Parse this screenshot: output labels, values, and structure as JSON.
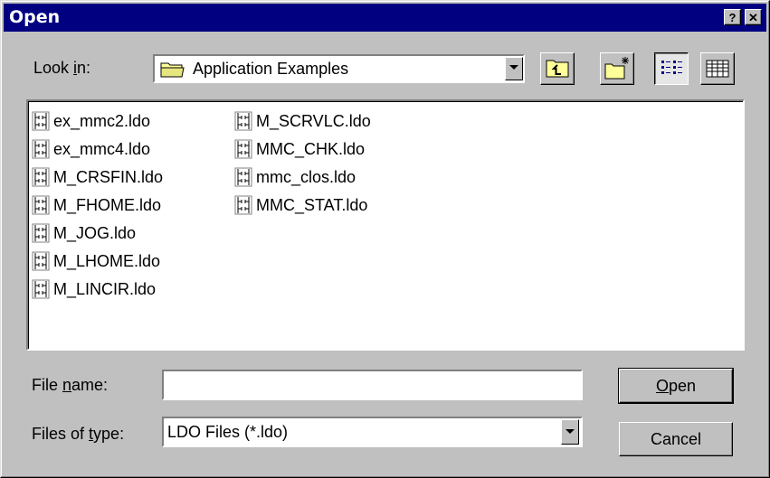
{
  "window": {
    "title": "Open",
    "help_glyph": "?",
    "close_glyph": "✕"
  },
  "lookin": {
    "label_pre": "Look ",
    "label_key": "i",
    "label_post": "n:",
    "value": "Application Examples",
    "icon": "folder-icon"
  },
  "toolbar": {
    "buttons": [
      {
        "name": "up-one-level",
        "icon": "folder-up-icon"
      },
      {
        "name": "create-new-folder",
        "icon": "new-folder-icon"
      },
      {
        "name": "list-view",
        "icon": "list-view-icon",
        "pressed": true
      },
      {
        "name": "details-view",
        "icon": "details-view-icon",
        "pressed": false
      }
    ]
  },
  "files": {
    "col1": [
      "ex_mmc2.ldo",
      "ex_mmc4.ldo",
      "M_CRSFIN.ldo",
      "M_FHOME.ldo",
      "M_JOG.ldo",
      "M_LHOME.ldo",
      "M_LINCIR.ldo"
    ],
    "col2": [
      "M_SCRVLC.ldo",
      "MMC_CHK.ldo",
      "mmc_clos.ldo",
      "MMC_STAT.ldo"
    ],
    "icon": "ldo-file-icon"
  },
  "filename": {
    "label_pre": "File ",
    "label_key": "n",
    "label_post": "ame:",
    "value": ""
  },
  "filetype": {
    "label_pre": "Files of ",
    "label_key": "t",
    "label_post": "ype:",
    "value": "LDO Files (*.ldo)"
  },
  "buttons": {
    "open_key": "O",
    "open_rest": "pen",
    "cancel": "Cancel"
  },
  "colors": {
    "titlebar": "#000080",
    "face": "#c0c0c0"
  }
}
